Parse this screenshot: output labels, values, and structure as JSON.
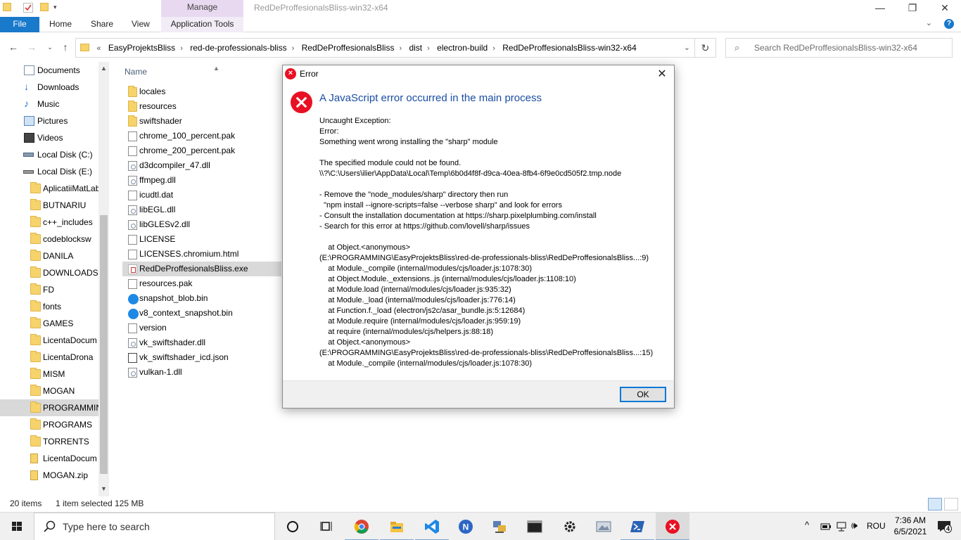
{
  "titlebar": {
    "context_tab": "Manage",
    "window_title": "RedDeProffesionalsBliss-win32-x64",
    "minimize": "—",
    "restore": "❐",
    "close": "✕"
  },
  "ribbon": {
    "tabs": [
      "File",
      "Home",
      "Share",
      "View",
      "Application Tools"
    ],
    "help": "?"
  },
  "address": {
    "crumbs": [
      "EasyProjektsBliss",
      "red-de-professionals-bliss",
      "RedDeProffesionalsBliss",
      "dist",
      "electron-build",
      "RedDeProffesionalsBliss-win32-x64"
    ],
    "search_placeholder": "Search RedDeProffesionalsBliss-win32-x64"
  },
  "nav": {
    "items": [
      {
        "label": "Documents",
        "icon": "documents-icon"
      },
      {
        "label": "Downloads",
        "icon": "downloads-icon"
      },
      {
        "label": "Music",
        "icon": "music-icon"
      },
      {
        "label": "Pictures",
        "icon": "pictures-icon"
      },
      {
        "label": "Videos",
        "icon": "videos-icon"
      },
      {
        "label": "Local Disk (C:)",
        "icon": "drive-icon"
      },
      {
        "label": "Local Disk (E:)",
        "icon": "drive-icon"
      },
      {
        "label": "AplicatiiMatLab",
        "icon": "folder-icon"
      },
      {
        "label": "BUTNARIU",
        "icon": "folder-icon"
      },
      {
        "label": "c++_includes",
        "icon": "folder-icon"
      },
      {
        "label": "codeblocksw",
        "icon": "folder-icon"
      },
      {
        "label": "DANILA",
        "icon": "folder-icon"
      },
      {
        "label": "DOWNLOADS",
        "icon": "folder-icon"
      },
      {
        "label": "FD",
        "icon": "folder-icon"
      },
      {
        "label": "fonts",
        "icon": "folder-icon"
      },
      {
        "label": "GAMES",
        "icon": "folder-icon"
      },
      {
        "label": "LicentaDocum",
        "icon": "folder-icon"
      },
      {
        "label": "LicentaDrona",
        "icon": "folder-icon"
      },
      {
        "label": "MISM",
        "icon": "folder-icon"
      },
      {
        "label": "MOGAN",
        "icon": "folder-icon"
      },
      {
        "label": "PROGRAMMIN",
        "icon": "folder-icon",
        "selected": true
      },
      {
        "label": "PROGRAMS",
        "icon": "folder-icon"
      },
      {
        "label": "TORRENTS",
        "icon": "folder-icon"
      },
      {
        "label": "LicentaDocum",
        "icon": "zip-icon"
      },
      {
        "label": "MOGAN.zip",
        "icon": "zip-icon"
      }
    ]
  },
  "filelist": {
    "column_name": "Name",
    "files": [
      {
        "name": "locales",
        "type": "folder"
      },
      {
        "name": "resources",
        "type": "folder"
      },
      {
        "name": "swiftshader",
        "type": "folder"
      },
      {
        "name": "chrome_100_percent.pak",
        "type": "doc"
      },
      {
        "name": "chrome_200_percent.pak",
        "type": "doc"
      },
      {
        "name": "d3dcompiler_47.dll",
        "type": "dll"
      },
      {
        "name": "ffmpeg.dll",
        "type": "dll"
      },
      {
        "name": "icudtl.dat",
        "type": "doc"
      },
      {
        "name": "libEGL.dll",
        "type": "dll"
      },
      {
        "name": "libGLESv2.dll",
        "type": "dll"
      },
      {
        "name": "LICENSE",
        "type": "doc"
      },
      {
        "name": "LICENSES.chromium.html",
        "type": "doc"
      },
      {
        "name": "RedDeProffesionalsBliss.exe",
        "type": "exe",
        "selected": true
      },
      {
        "name": "resources.pak",
        "type": "doc"
      },
      {
        "name": "snapshot_blob.bin",
        "type": "blob"
      },
      {
        "name": "v8_context_snapshot.bin",
        "type": "blob"
      },
      {
        "name": "version",
        "type": "doc"
      },
      {
        "name": "vk_swiftshader.dll",
        "type": "dll"
      },
      {
        "name": "vk_swiftshader_icd.json",
        "type": "json"
      },
      {
        "name": "vulkan-1.dll",
        "type": "dll"
      }
    ]
  },
  "statusbar": {
    "count": "20 items",
    "selection": "1 item selected",
    "size": "125 MB"
  },
  "dialog": {
    "title": "Error",
    "heading": "A JavaScript error occurred in the main process",
    "body_lines": [
      "Uncaught Exception:",
      "Error:",
      "Something went wrong installing the \"sharp\" module",
      "",
      "The specified module could not be found.",
      "\\\\?\\C:\\Users\\ilier\\AppData\\Local\\Temp\\6b0d4f8f-d9ca-40ea-8fb4-6f9e0cd505f2.tmp.node",
      "",
      "- Remove the \"node_modules/sharp\" directory then run",
      "  \"npm install --ignore-scripts=false --verbose sharp\" and look for errors",
      "- Consult the installation documentation at https://sharp.pixelplumbing.com/install",
      "- Search for this error at https://github.com/lovell/sharp/issues",
      "",
      "    at Object.<anonymous>",
      "(E:\\PROGRAMMING\\EasyProjektsBliss\\red-de-professionals-bliss\\RedDeProffesionalsBliss...:9)",
      "    at Module._compile (internal/modules/cjs/loader.js:1078:30)",
      "    at Object.Module._extensions..js (internal/modules/cjs/loader.js:1108:10)",
      "    at Module.load (internal/modules/cjs/loader.js:935:32)",
      "    at Module._load (internal/modules/cjs/loader.js:776:14)",
      "    at Function.f._load (electron/js2c/asar_bundle.js:5:12684)",
      "    at Module.require (internal/modules/cjs/loader.js:959:19)",
      "    at require (internal/modules/cjs/helpers.js:88:18)",
      "    at Object.<anonymous>",
      "(E:\\PROGRAMMING\\EasyProjektsBliss\\red-de-professionals-bliss\\RedDeProffesionalsBliss...:15)",
      "    at Module._compile (internal/modules/cjs/loader.js:1078:30)"
    ],
    "ok_label": "OK"
  },
  "taskbar": {
    "search_placeholder": "Type here to search",
    "apps": [
      "task-view",
      "widgets",
      "chrome",
      "file-explorer",
      "vscode",
      "app-n",
      "network-app",
      "terminal",
      "settings",
      "photos",
      "powershell",
      "error-app"
    ],
    "language": "ROU",
    "time": "7:36 AM",
    "date": "6/5/2021",
    "notification_count": "4"
  }
}
